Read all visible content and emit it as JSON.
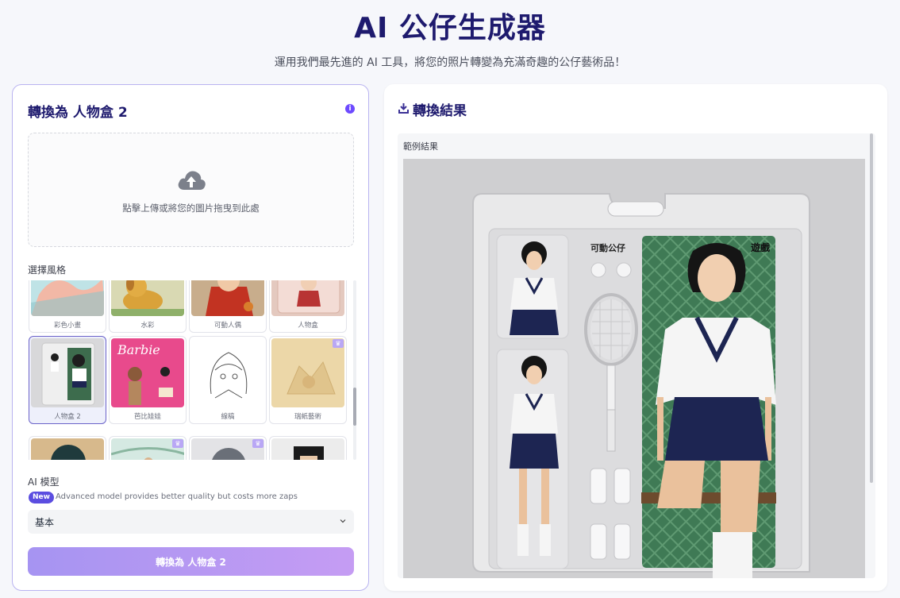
{
  "header": {
    "title": "AI 公仔生成器",
    "subtitle": "運用我們最先進的 AI 工具，將您的照片轉變為充滿奇趣的公仔藝術品！"
  },
  "left_panel": {
    "heading": "轉換為 人物盒 2",
    "upload_text": "點擊上傳或將您的圖片拖曳到此處",
    "style_label": "選擇風格",
    "styles": [
      {
        "name": "彩色小畫",
        "selected": false,
        "premium": false
      },
      {
        "name": "水彩",
        "selected": false,
        "premium": false
      },
      {
        "name": "可動人偶",
        "selected": false,
        "premium": false
      },
      {
        "name": "人物盒",
        "selected": false,
        "premium": false
      },
      {
        "name": "人物盒 2",
        "selected": true,
        "premium": false
      },
      {
        "name": "芭比娃娃",
        "selected": false,
        "premium": false
      },
      {
        "name": "線稿",
        "selected": false,
        "premium": false
      },
      {
        "name": "瑞紙藝術",
        "selected": false,
        "premium": true
      }
    ],
    "model_label": "AI 模型",
    "new_badge": "New",
    "model_note": "Advanced model provides better quality but costs more zaps",
    "model_selected": "基本",
    "convert_button": "轉換為 人物盒 2"
  },
  "right_panel": {
    "heading": "轉換結果",
    "sample_label": "範例結果",
    "package_label_top": "可動公仔",
    "package_label_right": "遊戲"
  },
  "colors": {
    "accent": "#5b4de0",
    "title": "#1e1a6e",
    "button_gradient_start": "#a694f2",
    "button_gradient_end": "#c59cf3"
  }
}
